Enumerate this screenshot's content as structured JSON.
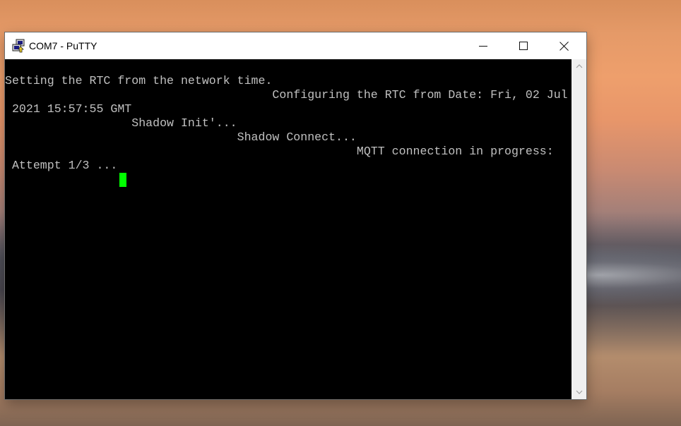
{
  "window": {
    "title": "COM7 - PuTTY",
    "icons": {
      "app": "putty-icon",
      "minimize": "minimize-icon",
      "maximize": "maximize-icon",
      "close": "close-icon"
    }
  },
  "terminal": {
    "lines": [
      "Setting the RTC from the network time.",
      "                                      Configuring the RTC from Date: Fri, 02 Jul",
      " 2021 15:57:55 GMT",
      "                  Shadow Init'...",
      "                                 Shadow Connect...",
      "                                                  MQTT connection in progress:",
      " Attempt 1/3 ..."
    ],
    "text_color": "#c0c0c0",
    "background_color": "#000000",
    "cursor_color": "#00ff00"
  },
  "scrollbar": {
    "up_icon": "chevron-up-icon",
    "down_icon": "chevron-down-icon"
  }
}
